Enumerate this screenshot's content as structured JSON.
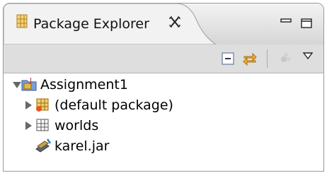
{
  "panel": {
    "tab_label": "Package Explorer",
    "close_glyph": "✕",
    "icons": [
      "package-explorer-icon",
      "close-icon",
      "minimize-icon",
      "maximize-icon"
    ]
  },
  "toolbar": {
    "buttons": [
      "collapse-all-icon",
      "link-with-editor-icon",
      "focus-on-active-task-icon",
      "view-menu-icon"
    ]
  },
  "tree": {
    "items": [
      {
        "label": "Assignment1",
        "expanded": true,
        "icon": "java-project-icon"
      },
      {
        "label": "(default package)",
        "expanded": false,
        "icon": "package-icon"
      },
      {
        "label": "worlds",
        "expanded": false,
        "icon": "folder-package-icon"
      },
      {
        "label": "karel.jar",
        "icon": "jar-icon"
      }
    ]
  },
  "colors": {
    "tab_bg": "#e8e8e8",
    "toolbar_bg": "#dedede",
    "package_icon": "#c79a2c",
    "link_icon": "#e0a020"
  }
}
